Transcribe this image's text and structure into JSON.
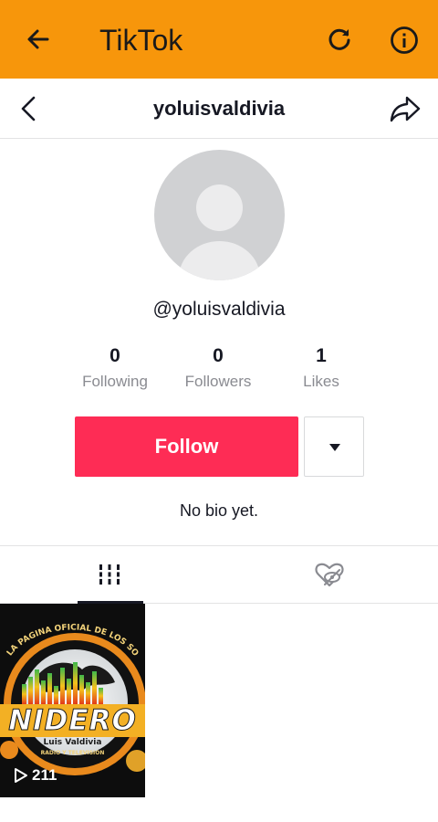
{
  "app_bar": {
    "title": "TikTok",
    "color": "#f7960b"
  },
  "profile_nav": {
    "username": "yoluisvaldivia"
  },
  "profile": {
    "handle": "@yoluisvaldivia",
    "stats": [
      {
        "value": "0",
        "label": "Following"
      },
      {
        "value": "0",
        "label": "Followers"
      },
      {
        "value": "1",
        "label": "Likes"
      }
    ],
    "follow_label": "Follow",
    "follow_color": "#fe2c55",
    "bio": "No bio yet."
  },
  "tabs": [
    {
      "icon": "grid-icon",
      "active": true
    },
    {
      "icon": "heart-hidden-icon",
      "active": false
    }
  ],
  "videos": [
    {
      "views": "211",
      "thumbnail_text": [
        "LA PAGINA OFICIAL DE LOS SONIDOS",
        "NIDERO",
        "Luis Valdivia",
        "RADIO Y TELEVISION"
      ]
    }
  ]
}
